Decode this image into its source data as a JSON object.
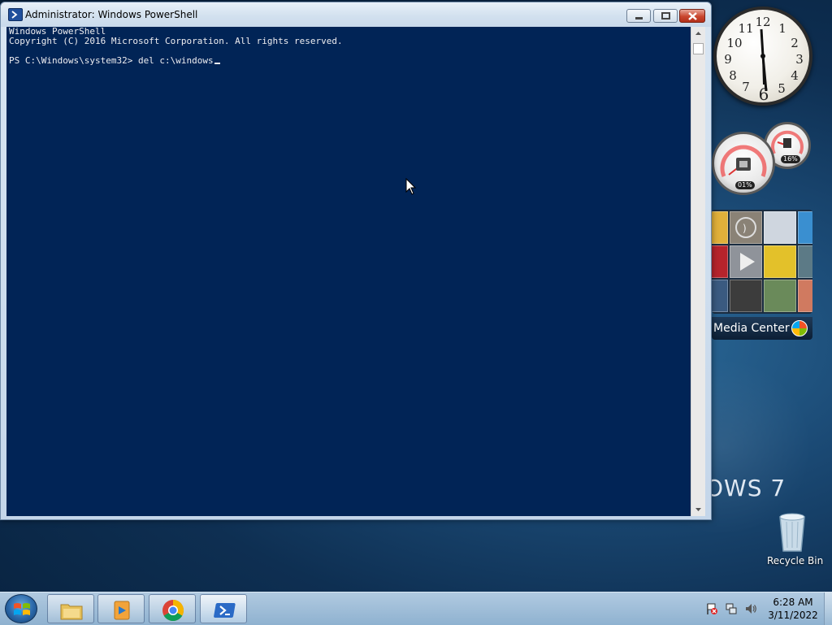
{
  "window": {
    "title": "Administrator: Windows PowerShell",
    "icon": "powershell-icon",
    "controls": [
      "minimize-icon",
      "maximize-icon",
      "close-icon"
    ]
  },
  "console": {
    "lines": [
      "Windows PowerShell",
      "Copyright (C) 2016 Microsoft Corporation. All rights reserved.",
      "",
      "PS C:\\Windows\\system32> del c:\\windows"
    ],
    "background": "#012456",
    "foreground": "#eeedf0"
  },
  "gadgets": {
    "clock": {
      "numbers": [
        "12",
        "1",
        "2",
        "3",
        "4",
        "5",
        "6",
        "7",
        "8",
        "9",
        "10",
        "11"
      ],
      "time": "6:28"
    },
    "cpu_meter": {
      "cpu_label": "01%",
      "cpu_value": 0.01,
      "memory_label": "16%",
      "memory_value": 0.16
    },
    "media_center": {
      "label": "Media Center"
    }
  },
  "desktop": {
    "wallpaper_text": "OWS 7",
    "recycle_bin_label": "Recycle Bin"
  },
  "taskbar": {
    "buttons": [
      {
        "name": "windows-explorer",
        "icon": "folder-icon"
      },
      {
        "name": "windows-media-player",
        "icon": "media-player-icon"
      },
      {
        "name": "google-chrome",
        "icon": "chrome-icon"
      },
      {
        "name": "windows-powershell",
        "icon": "powershell-icon",
        "active": true
      }
    ],
    "tray_icons": [
      "action-center-flag-icon",
      "network-icon",
      "volume-icon"
    ],
    "time": "6:28 AM",
    "date": "3/11/2022"
  }
}
